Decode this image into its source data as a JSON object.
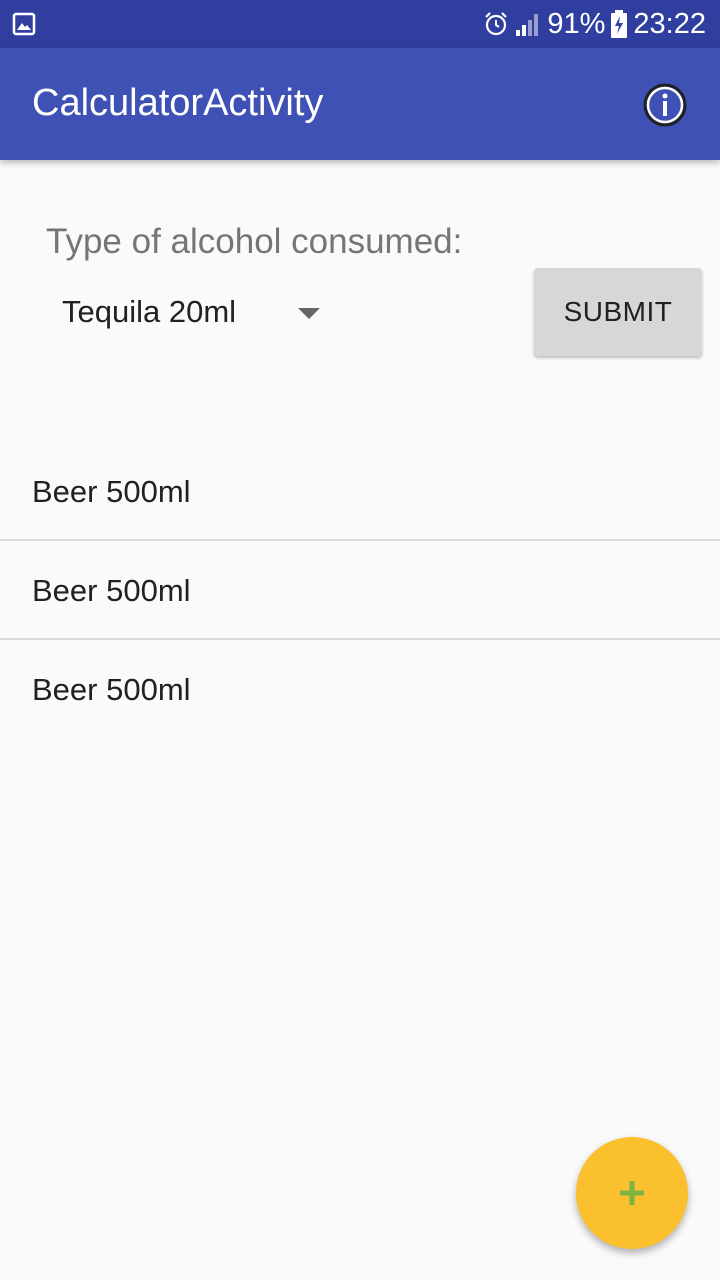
{
  "status_bar": {
    "battery": "91%",
    "time": "23:22",
    "icons": [
      "gallery-icon",
      "alarm-icon",
      "signal-icon",
      "battery-charging-icon"
    ]
  },
  "app_bar": {
    "title": "CalculatorActivity",
    "info_icon": "info-icon"
  },
  "form": {
    "prompt": "Type of alcohol consumed:",
    "selected_drink": "Tequila 20ml",
    "submit_label": "SUBMIT"
  },
  "consumed_list": [
    {
      "label": "Beer 500ml"
    },
    {
      "label": "Beer 500ml"
    },
    {
      "label": "Beer 500ml"
    }
  ],
  "fab": {
    "icon": "plus-icon"
  },
  "colors": {
    "status_bar": "#303f9f",
    "app_bar": "#3f51b5",
    "fab": "#fbc02d",
    "fab_icon": "#7cb342"
  }
}
